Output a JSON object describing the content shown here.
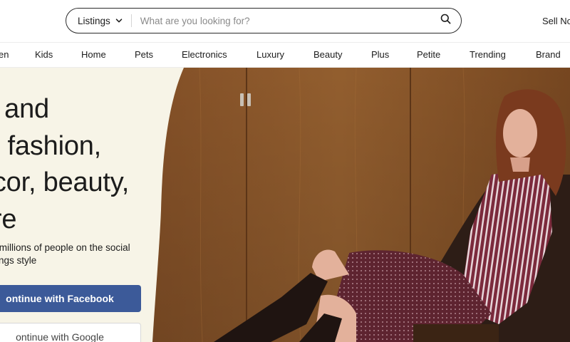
{
  "header": {
    "search": {
      "dropdown_label": "Listings",
      "placeholder": "What are you looking for?"
    },
    "sell_link": "Sell No"
  },
  "category_nav": {
    "items": [
      "en",
      "Kids",
      "Home",
      "Pets",
      "Electronics",
      "Luxury",
      "Beauty",
      "Plus",
      "Petite",
      "Trending",
      "Brand"
    ]
  },
  "hero": {
    "headline_lines": [
      "ell, and",
      "ver fashion,",
      "decor, beauty,",
      "nore"
    ],
    "subtext_lines": [
      "join millions of people on the social",
      "ll things style"
    ],
    "facebook_button": "ontinue with Facebook",
    "google_button": "ontinue with Google"
  },
  "colors": {
    "cream": "#f7f4e7",
    "facebook_blue": "#3c5a99",
    "wood": "#8e5a2e",
    "text": "#1c1c1c"
  },
  "icons": {
    "dropdown": "chevron-down-icon",
    "search": "search-icon"
  }
}
